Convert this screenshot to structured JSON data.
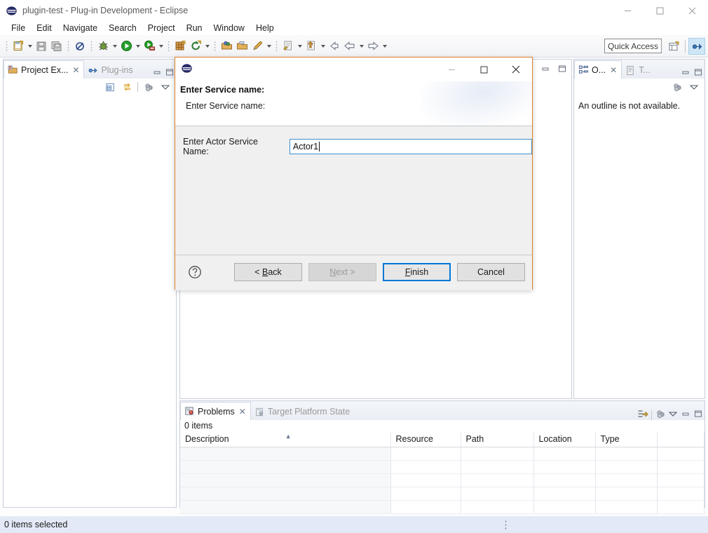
{
  "window": {
    "title": "plugin-test - Plug-in Development - Eclipse",
    "icon": "eclipse-icon",
    "controls": [
      {
        "name": "minimize",
        "glyph": "minimize-icon"
      },
      {
        "name": "maximize",
        "glyph": "maximize-icon"
      },
      {
        "name": "close",
        "glyph": "close-icon"
      }
    ]
  },
  "menubar": {
    "items": [
      {
        "label": "File"
      },
      {
        "label": "Edit"
      },
      {
        "label": "Navigate"
      },
      {
        "label": "Search"
      },
      {
        "label": "Project"
      },
      {
        "label": "Run"
      },
      {
        "label": "Window"
      },
      {
        "label": "Help"
      }
    ]
  },
  "toolbar": {
    "quick_access_placeholder": "Quick Access",
    "buttons": [
      {
        "name": "new-wizard",
        "icon": "new-file-icon"
      },
      {
        "name": "save",
        "icon": "save-icon"
      },
      {
        "name": "save-all",
        "icon": "save-all-icon"
      },
      {
        "name": "toggle-breakpoint",
        "icon": "skip-breakpoints-icon"
      },
      {
        "name": "debug",
        "icon": "debug-bug-icon"
      },
      {
        "name": "run",
        "icon": "run-play-icon"
      },
      {
        "name": "run-server",
        "icon": "run-server-icon"
      },
      {
        "name": "new-plugin-project",
        "icon": "plugin-project-icon"
      },
      {
        "name": "refresh-target",
        "icon": "refresh-icon"
      },
      {
        "name": "open-type",
        "icon": "open-type-icon"
      },
      {
        "name": "open-task",
        "icon": "open-folder-icon"
      },
      {
        "name": "search",
        "icon": "search-pen-icon"
      },
      {
        "name": "next-annotation",
        "icon": "next-annotation-icon"
      },
      {
        "name": "previous-annotation",
        "icon": "previous-annotation-icon"
      },
      {
        "name": "last-edit-location",
        "icon": "last-edit-icon"
      },
      {
        "name": "back",
        "icon": "back-arrow-icon"
      },
      {
        "name": "forward",
        "icon": "forward-arrow-icon"
      }
    ],
    "perspective_buttons": [
      {
        "name": "open-perspective",
        "icon": "open-perspective-icon"
      },
      {
        "name": "plug-in-development-perspective",
        "icon": "plugin-perspective-icon",
        "active": true
      }
    ]
  },
  "project_explorer": {
    "tabs": [
      {
        "label": "Project Ex...",
        "active": true,
        "closable": true
      },
      {
        "label": "Plug-ins",
        "active": false,
        "closable": false
      }
    ],
    "toolbar": [
      {
        "name": "collapse-all",
        "icon": "collapse-all-icon"
      },
      {
        "name": "link-with-editor",
        "icon": "link-editor-icon"
      },
      {
        "name": "focus-on-active-task",
        "icon": "focus-icon"
      },
      {
        "name": "view-menu",
        "icon": "view-menu-icon"
      }
    ]
  },
  "editor_area": {
    "toolbar": [
      {
        "name": "minimize",
        "icon": "minimize-view-icon"
      },
      {
        "name": "maximize",
        "icon": "maximize-view-icon"
      }
    ]
  },
  "outline_view": {
    "tabs": [
      {
        "label": "O...",
        "active": true,
        "closable": true
      },
      {
        "label": "T...",
        "active": false,
        "closable": false
      }
    ],
    "toolbar": [
      {
        "name": "focus-on-active-task",
        "icon": "focus-icon"
      },
      {
        "name": "view-menu",
        "icon": "view-menu-icon"
      }
    ],
    "message": "An outline is not available."
  },
  "problems_view": {
    "tabs": [
      {
        "label": "Problems",
        "active": true,
        "closable": true
      },
      {
        "label": "Target Platform State",
        "active": false,
        "closable": false
      }
    ],
    "toolbar": [
      {
        "name": "filters",
        "icon": "filter-icon"
      },
      {
        "name": "focus-on-active-task",
        "icon": "focus-icon"
      },
      {
        "name": "view-menu",
        "icon": "view-menu-icon"
      },
      {
        "name": "minimize",
        "icon": "minimize-view-icon"
      },
      {
        "name": "maximize",
        "icon": "maximize-view-icon"
      }
    ],
    "items_count": "0 items",
    "columns": [
      {
        "label": "Description",
        "sorted": "asc"
      },
      {
        "label": "Resource"
      },
      {
        "label": "Path"
      },
      {
        "label": "Location"
      },
      {
        "label": "Type"
      }
    ],
    "rows": []
  },
  "statusbar": {
    "text": "0 items selected"
  },
  "dialog": {
    "icon": "eclipse-icon",
    "controls": [
      {
        "name": "minimize",
        "glyph": "minimize-icon",
        "dim": true
      },
      {
        "name": "maximize",
        "glyph": "maximize-icon"
      },
      {
        "name": "close",
        "glyph": "close-icon"
      }
    ],
    "heading": "Enter Service name:",
    "subheading": "Enter Service name:",
    "field": {
      "label": "Enter Actor Service Name:",
      "value": "Actor1",
      "placeholder": ""
    },
    "help_icon": "help-icon",
    "buttons": [
      {
        "label": "< Back",
        "name": "back-button",
        "state": "normal",
        "mnemonic": "B"
      },
      {
        "label": "Next >",
        "name": "next-button",
        "state": "disabled",
        "mnemonic": "N"
      },
      {
        "label": "Finish",
        "name": "finish-button",
        "state": "default",
        "mnemonic": "F"
      },
      {
        "label": "Cancel",
        "name": "cancel-button",
        "state": "normal",
        "mnemonic": ""
      }
    ]
  },
  "colors": {
    "dialog_border": "#e0832a",
    "default_button_border": "#0078d7",
    "focus_input_border": "#3f8fd0",
    "statusbar_bg": "#e3e9f7"
  }
}
